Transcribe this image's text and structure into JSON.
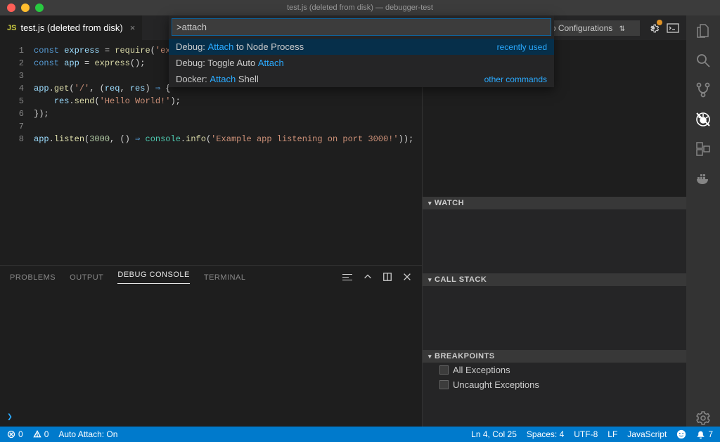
{
  "titlebar": {
    "title": "test.js (deleted from disk) — debugger-test"
  },
  "tab": {
    "icon_label": "JS",
    "filename": "test.js (deleted from disk)"
  },
  "debug_toolbar": {
    "config": "No Configurations"
  },
  "palette": {
    "input_value": ">attach",
    "items": [
      {
        "prefix": "Debug: ",
        "highlight": "Attach",
        "suffix": " to Node Process",
        "hint": "recently used"
      },
      {
        "prefix": "Debug: Toggle Auto ",
        "highlight": "Attach",
        "suffix": "",
        "hint": ""
      },
      {
        "prefix": "Docker: ",
        "highlight": "Attach",
        "suffix": " Shell",
        "hint": "other commands"
      }
    ]
  },
  "editor": {
    "line_numbers": [
      "1",
      "2",
      "3",
      "4",
      "5",
      "6",
      "7",
      "8"
    ]
  },
  "panel": {
    "tabs": {
      "problems": "PROBLEMS",
      "output": "OUTPUT",
      "debug_console": "DEBUG CONSOLE",
      "terminal": "TERMINAL"
    },
    "prompt": "❯"
  },
  "debug_sidebar": {
    "watch": "WATCH",
    "callstack": "CALL STACK",
    "breakpoints": "BREAKPOINTS",
    "bp_items": [
      "All Exceptions",
      "Uncaught Exceptions"
    ]
  },
  "statusbar": {
    "errors": "0",
    "warnings": "0",
    "auto_attach": "Auto Attach: On",
    "ln_col": "Ln 4, Col 25",
    "spaces": "Spaces: 4",
    "encoding": "UTF-8",
    "eol": "LF",
    "language": "JavaScript",
    "notifications": "7"
  }
}
